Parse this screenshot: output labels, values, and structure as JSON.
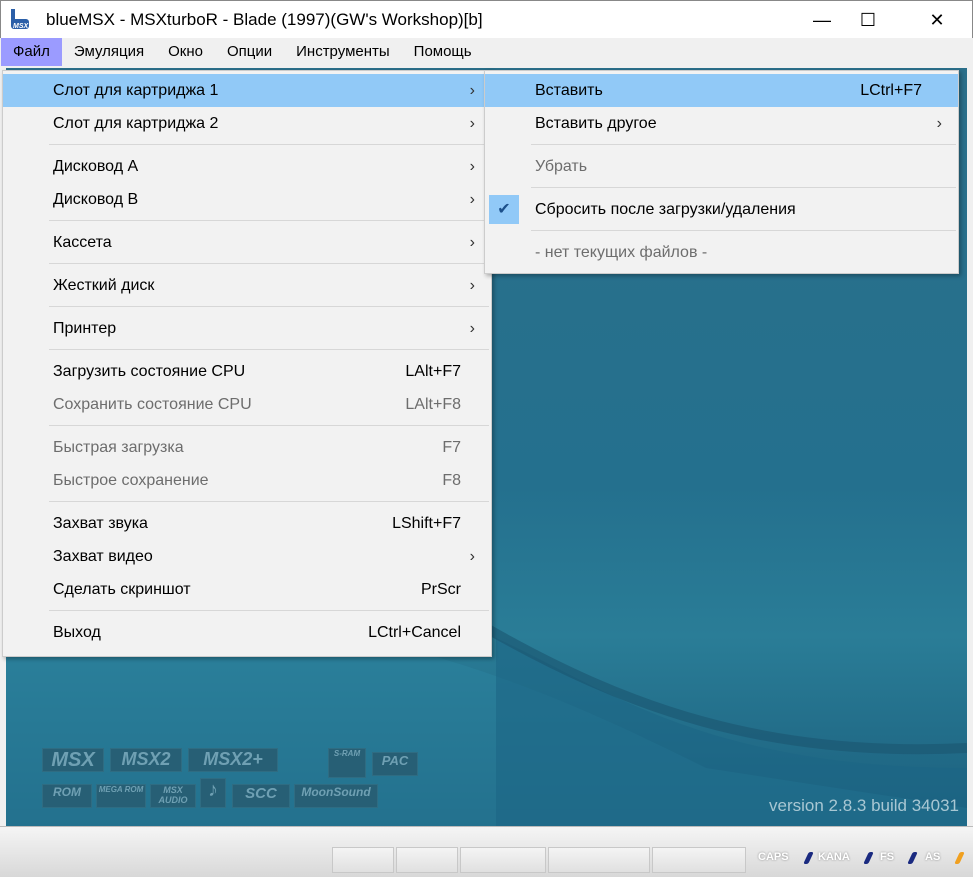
{
  "window": {
    "title": "blueMSX - MSXturboR - Blade (1997)(GW's Workshop)[b]",
    "minimize": "—",
    "maximize": "☐",
    "close": "✕"
  },
  "menubar": [
    "Файл",
    "Эмуляция",
    "Окно",
    "Опции",
    "Инструменты",
    "Помощь"
  ],
  "file_menu": {
    "cart1": "Слот для картриджа 1",
    "cart2": "Слот для картриджа 2",
    "diskA": "Дисковод A",
    "diskB": "Дисковод B",
    "cassette": "Кассета",
    "harddisk": "Жесткий диск",
    "printer": "Принтер",
    "load_state": "Загрузить состояние CPU",
    "load_state_sc": "LAlt+F7",
    "save_state": "Сохранить состояние CPU",
    "save_state_sc": "LAlt+F8",
    "quick_load": "Быстрая загрузка",
    "quick_load_sc": "F7",
    "quick_save": "Быстрое сохранение",
    "quick_save_sc": "F8",
    "audio_cap": "Захват звука",
    "audio_cap_sc": "LShift+F7",
    "video_cap": "Захват видео",
    "screenshot": "Сделать скриншот",
    "screenshot_sc": "PrScr",
    "exit": "Выход",
    "exit_sc": "LCtrl+Cancel",
    "arrow": "›"
  },
  "cart_submenu": {
    "insert": "Вставить",
    "insert_sc": "LCtrl+F7",
    "insert_other": "Вставить другое",
    "remove": "Убрать",
    "reset": "Сбросить после загрузки/удаления",
    "reset_checked": true,
    "check": "✔",
    "no_files": "- нет текущих файлов -"
  },
  "screen": {
    "version": "version 2.8.3 build 34031",
    "logos": [
      "MSX",
      "MSX2",
      "MSX2+",
      "S-RAM",
      "PAC",
      "ROM",
      "MEGA ROM",
      "MSX AUDIO",
      "♪",
      "SCC",
      "MoonSound"
    ]
  },
  "status": {
    "indicators": [
      "CAPS",
      "KANA",
      "FS",
      "AS"
    ]
  }
}
